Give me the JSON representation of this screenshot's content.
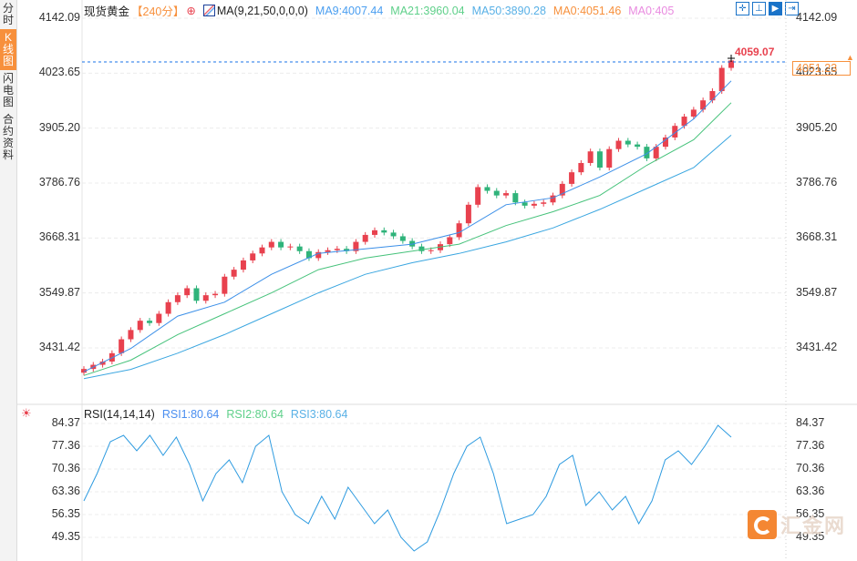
{
  "sidebar": {
    "tabs": [
      {
        "label": "分时",
        "active": false
      },
      {
        "label": "K线图",
        "active": true
      },
      {
        "label": "闪电图",
        "active": false
      },
      {
        "label": "合约资料",
        "active": false
      }
    ]
  },
  "header": {
    "symbol": "现货黄金",
    "period": "【240分】",
    "ma_params": "MA(9,21,50,0,0,0)",
    "ma9": "MA9:4007.44",
    "ma21": "MA21:3960.04",
    "ma50": "MA50:3890.28",
    "ma0a": "MA0:4051.46",
    "ma0b": "MA0:405"
  },
  "rsi_header": {
    "params": "RSI(14,14,14)",
    "rsi1": "RSI1:80.64",
    "rsi2": "RSI2:80.64",
    "rsi3": "RSI3:80.64"
  },
  "toolbar": [
    "crosshair-tool",
    "range-tool",
    "draw-tool",
    "export-tool"
  ],
  "colors": {
    "up": "#e8414e",
    "down": "#2fb37a",
    "ma9": "#3b8fe8",
    "ma21": "#45c27a",
    "ma50": "#3aa6e0",
    "rsi": "#2e9be0",
    "accent": "#f7903c"
  },
  "chart_data": [
    {
      "type": "candlestick",
      "title": "现货黄金 240分",
      "y_ticks": [
        "4142.09",
        "4023.65",
        "3905.20",
        "3786.76",
        "3668.31",
        "3549.87",
        "3431.42"
      ],
      "ylim": [
        3431.42,
        4142.09
      ],
      "high_marker": "4059.07",
      "last_price": "4051.23",
      "closes": [
        3386,
        3395,
        3402,
        3420,
        3450,
        3470,
        3490,
        3485,
        3505,
        3530,
        3545,
        3560,
        3533,
        3545,
        3548,
        3585,
        3600,
        3620,
        3635,
        3648,
        3660,
        3648,
        3650,
        3640,
        3625,
        3638,
        3642,
        3645,
        3640,
        3660,
        3675,
        3685,
        3680,
        3672,
        3662,
        3650,
        3640,
        3642,
        3655,
        3670,
        3700,
        3740,
        3778,
        3770,
        3760,
        3765,
        3745,
        3738,
        3742,
        3745,
        3760,
        3785,
        3810,
        3830,
        3855,
        3820,
        3860,
        3878,
        3870,
        3865,
        3840,
        3865,
        3885,
        3910,
        3930,
        3945,
        3965,
        3985,
        4035,
        4051
      ],
      "ma_sample_index": [
        0,
        5,
        10,
        15,
        20,
        25,
        30,
        35,
        40,
        45,
        50,
        55,
        60,
        65,
        69
      ],
      "series": [
        {
          "name": "MA9",
          "values": [
            3380,
            3430,
            3500,
            3530,
            3590,
            3635,
            3645,
            3655,
            3680,
            3740,
            3755,
            3800,
            3850,
            3925,
            4007
          ]
        },
        {
          "name": "MA21",
          "values": [
            3372,
            3405,
            3460,
            3505,
            3550,
            3600,
            3625,
            3640,
            3655,
            3695,
            3725,
            3760,
            3825,
            3880,
            3960
          ]
        },
        {
          "name": "MA50",
          "values": [
            3365,
            3385,
            3420,
            3460,
            3505,
            3550,
            3590,
            3615,
            3635,
            3660,
            3690,
            3730,
            3775,
            3820,
            3890
          ]
        }
      ]
    },
    {
      "type": "line",
      "title": "RSI(14,14,14)",
      "y_ticks": [
        "84.37",
        "77.36",
        "70.36",
        "63.36",
        "56.35",
        "49.35"
      ],
      "ylim": [
        49.35,
        84.37
      ],
      "values": [
        60.55,
        68.96,
        78.77,
        80.73,
        75.96,
        80.73,
        74.56,
        80.17,
        71.76,
        60.55,
        68.96,
        73.16,
        66.16,
        77.37,
        80.73,
        63.36,
        56.35,
        53.55,
        61.95,
        54.95,
        64.76,
        59.15,
        53.55,
        57.75,
        49.35,
        45.14,
        47.94,
        57.75,
        68.96,
        77.37,
        80.17,
        68.96,
        53.55,
        54.95,
        56.35,
        61.95,
        71.76,
        74.56,
        59.15,
        63.36,
        57.75,
        61.95,
        53.55,
        60.55,
        73.16,
        75.96,
        71.76,
        77.37,
        83.81,
        80.17
      ]
    }
  ],
  "logo": "汇金网"
}
